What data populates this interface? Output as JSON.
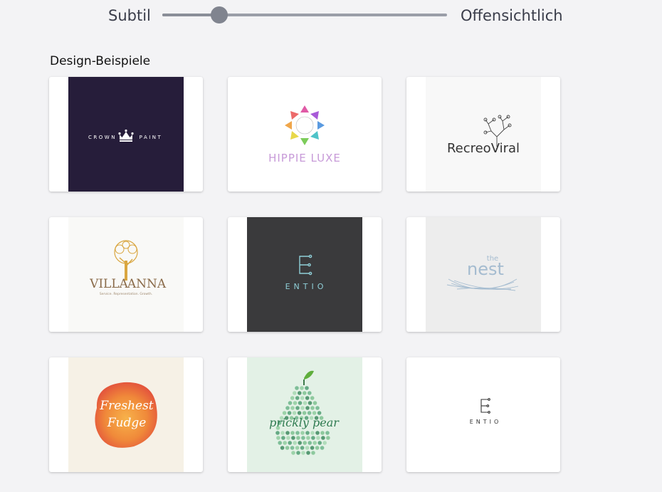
{
  "slider": {
    "label_left": "Subtil",
    "label_right": "Offensichtlich",
    "value": 0.2,
    "track_color": "#9a9ea8",
    "thumb_color": "#80848f"
  },
  "section": {
    "title": "Design-Beispiele"
  },
  "cards": [
    {
      "logo": "crown-paint-logo",
      "text_left": "CROWN",
      "text_right": "PAINT",
      "bg": "#261d3a",
      "fg": "#ffffff"
    },
    {
      "logo": "hippie-luxe-logo",
      "text": "HIPPIE LUXE",
      "bg": "#ffffff"
    },
    {
      "logo": "recreoviral-logo",
      "text": "RecreoViral",
      "bg": "#f8f8f8",
      "fg": "#333333"
    },
    {
      "logo": "villa-anna-logo",
      "text_left": "VILLA",
      "text_right": "ANNA",
      "tagline": "Service. Representation. Growth.",
      "bg": "#f9f9f7",
      "fg": "#8a6b4a",
      "accent": "#d9a640"
    },
    {
      "logo": "entio-logo-dark",
      "text": "ENTIO",
      "bg": "#3a3a3c",
      "fg": "#8fcfd8"
    },
    {
      "logo": "the-nest-logo",
      "text_small": "the",
      "text": "nest",
      "bg": "#ededed",
      "fg": "#a5bcd0"
    },
    {
      "logo": "freshest-fudge-logo",
      "text_line1": "Freshest",
      "text_line2": "Fudge",
      "bg": "#f6f1e6",
      "accent": "#f08a3a"
    },
    {
      "logo": "prickly-pear-logo",
      "text": "prickly pear",
      "bg": "#e3f1e6",
      "accent": "#6cb58a"
    },
    {
      "logo": "entio-logo-light",
      "text": "ENTIO",
      "bg": "#ffffff",
      "fg": "#333333"
    }
  ]
}
